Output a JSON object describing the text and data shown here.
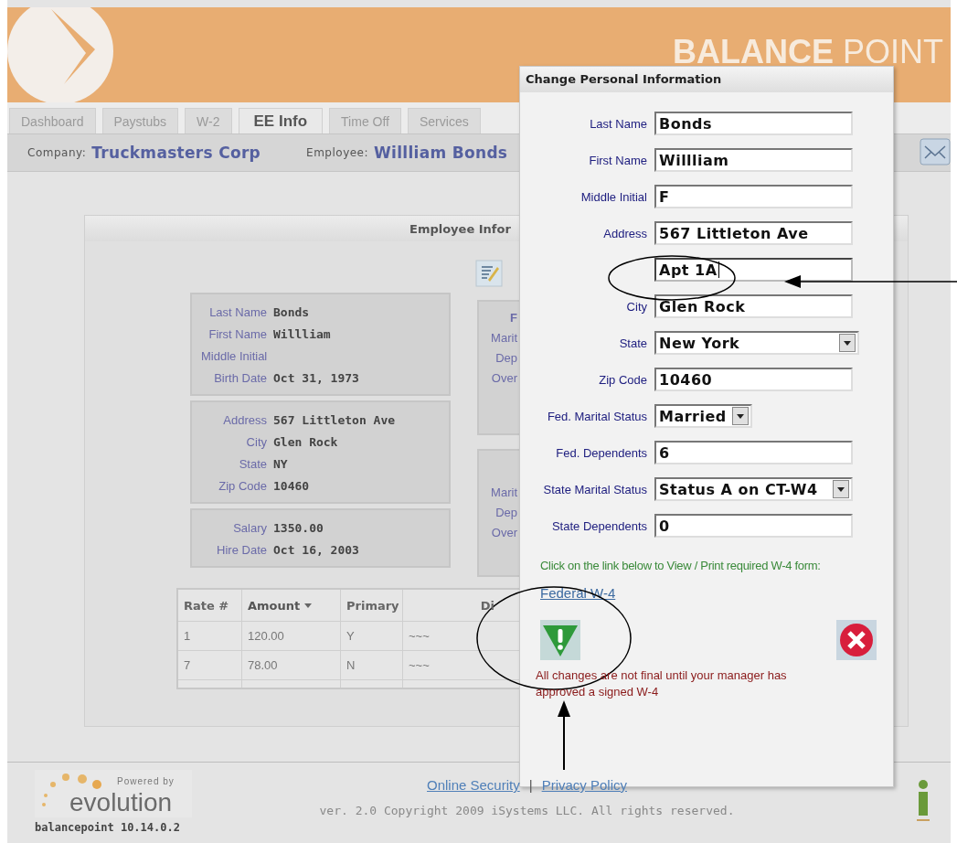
{
  "header": {
    "brand": "**BALANCE** POINT"
  },
  "tabs": [
    {
      "label": "Dashboard",
      "selected": false
    },
    {
      "label": "Paystubs",
      "selected": false
    },
    {
      "label": "W-2",
      "selected": false
    },
    {
      "label": "EE Info",
      "selected": true
    },
    {
      "label": "Time Off",
      "selected": false
    },
    {
      "label": "Services",
      "selected": false
    }
  ],
  "context_bar": {
    "company_label": "Company:",
    "company": "Truckmasters Corp",
    "employee_label": "Employee:",
    "employee": "Willliam Bonds"
  },
  "employee_panel": {
    "title": "Employee Infor",
    "summary_groups": [
      [
        {
          "label": "Last Name",
          "value": "Bonds"
        },
        {
          "label": "First Name",
          "value": "Willliam"
        },
        {
          "label": "Middle Initial"
        },
        {
          "label": "Birth Date",
          "value": "Oct 31, 1973"
        }
      ],
      [
        {
          "label": "Address",
          "value": "567 Littleton Ave"
        },
        {
          "label": "City",
          "value": "Glen Rock"
        },
        {
          "label": "State",
          "value": "NY"
        },
        {
          "label": "Zip Code",
          "value": "10460"
        }
      ],
      [
        {
          "label": "Salary",
          "value": "1350.00"
        },
        {
          "label": "Hire Date",
          "value": "Oct 16, 2003"
        }
      ]
    ],
    "side_groups": [
      {
        "heading": "F",
        "labels": [
          "Marit",
          "Dep",
          "Over"
        ]
      },
      {
        "labels": [
          "Marit",
          "Dep",
          "Over"
        ]
      }
    ],
    "rates_table": {
      "columns": [
        {
          "label": "Rate #",
          "sorted": false
        },
        {
          "label": "Amount",
          "sorted": true
        },
        {
          "label": "Primary",
          "sorted": false
        },
        {
          "label": "Di",
          "sorted": false
        }
      ],
      "rows": [
        [
          "1",
          "120.00",
          "Y",
          "~~~"
        ],
        [
          "7",
          "78.00",
          "N",
          "~~~"
        ]
      ]
    }
  },
  "dialog": {
    "title": "Change Personal Information",
    "fields": [
      {
        "label": "Last Name",
        "value": "Bonds",
        "kind": "text",
        "focused": false
      },
      {
        "label": "First Name",
        "value": "Willliam",
        "kind": "text",
        "focused": false
      },
      {
        "label": "Middle Initial",
        "value": "F",
        "kind": "text",
        "focused": false
      },
      {
        "label": "Address",
        "value": "567 Littleton Ave",
        "kind": "text",
        "focused": false
      },
      {
        "value": "Apt 1A",
        "kind": "text",
        "focused": true
      },
      {
        "label": "City",
        "value": "Glen Rock",
        "kind": "text",
        "focused": false
      },
      {
        "label": "State",
        "value": "New York",
        "kind": "select",
        "focused": false
      },
      {
        "label": "Zip Code",
        "value": "10460",
        "kind": "text",
        "focused": false
      },
      {
        "label": "Fed. Marital Status",
        "value": "Married",
        "kind": "short-select",
        "focused": false
      },
      {
        "label": "Fed. Dependents",
        "value": "6",
        "kind": "text",
        "focused": false
      },
      {
        "label": "State Marital Status",
        "value": "Status A on CT-W4",
        "kind": "select",
        "focused": false
      },
      {
        "label": "State Dependents",
        "value": "0",
        "kind": "text",
        "focused": false
      }
    ],
    "instruction": "Click on the link below to View / Print required W-4 form:",
    "link": "Federal W-4",
    "warning": "All changes are not final until your manager has approved a signed W-4"
  },
  "footer": {
    "powered_by": "Powered by",
    "product": "evolution",
    "version": "balancepoint  10.14.0.2",
    "links": [
      "Online Security",
      "Privacy Policy"
    ],
    "separator": "|",
    "copyright": "ver. 2.0 Copyright 2009 iSystems LLC. All rights reserved."
  }
}
